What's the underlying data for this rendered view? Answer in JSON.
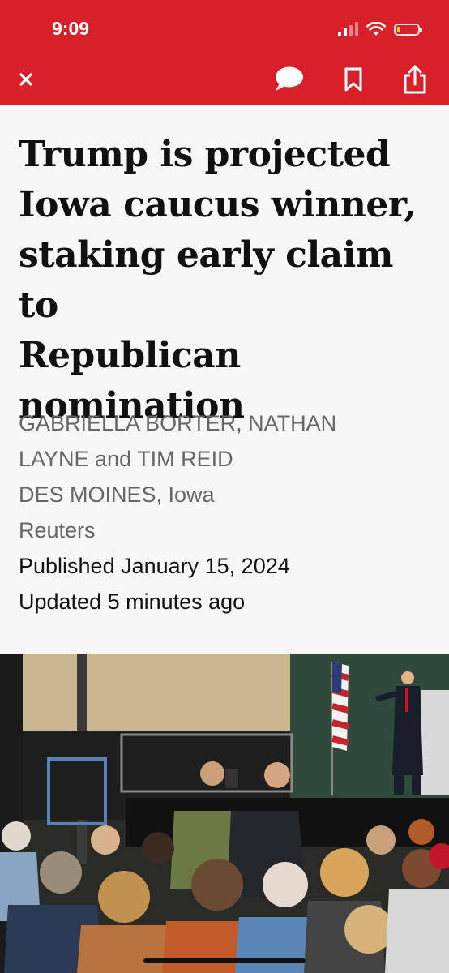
{
  "status_bar": {
    "time": "9:09"
  },
  "toolbar": {
    "close_icon": "close-icon",
    "comment_icon": "speech-bubble-icon",
    "bookmark_icon": "bookmark-icon",
    "share_icon": "share-icon",
    "accent_color": "#d8202a"
  },
  "article": {
    "headline_lines": [
      "Trump is projected",
      "Iowa caucus winner,",
      "staking early claim to",
      "Republican",
      "nomination"
    ],
    "authors_line1": "GABRIELLA BORTER, NATHAN",
    "authors_line2": "LAYNE and TIM REID",
    "dateline": "DES MOINES, Iowa",
    "source": "Reuters",
    "published": "Published January 15, 2024",
    "updated": "Updated 5 minutes ago"
  },
  "photo": {
    "description_icon": "rally-photo"
  }
}
